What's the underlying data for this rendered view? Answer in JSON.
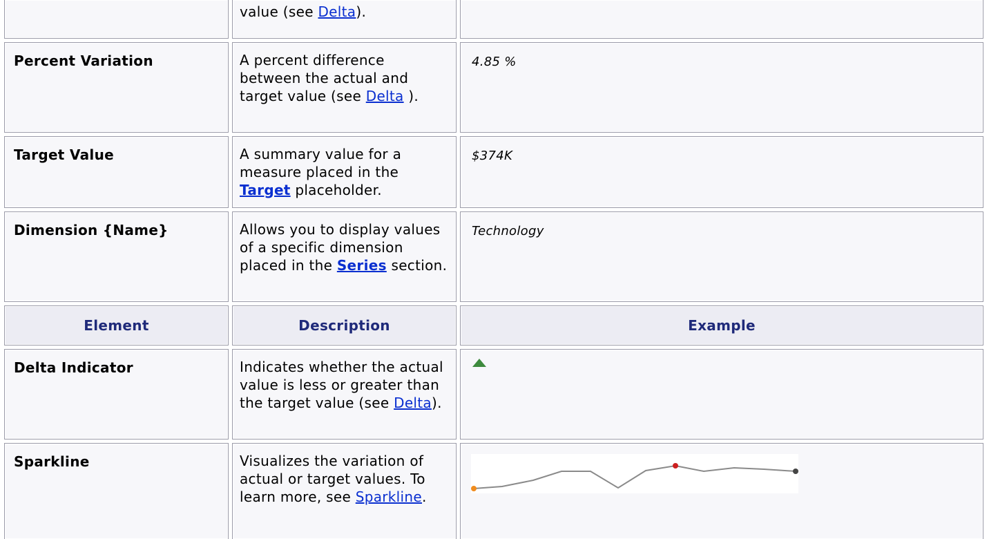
{
  "rows": [
    {
      "element": "",
      "description": [
        "value (see ",
        {
          "link": "Delta"
        },
        ")."
      ],
      "example": ""
    },
    {
      "element": "Percent Variation",
      "description": [
        "A percent difference between the actual and target value (see ",
        {
          "link": "Delta"
        },
        " )."
      ],
      "example": "4.85 %"
    },
    {
      "element": "Target Value",
      "description": [
        "A summary value for a measure placed in the ",
        {
          "link": "Target",
          "bold": true
        },
        " placeholder."
      ],
      "example": "$374K"
    },
    {
      "element": "Dimension {Name}",
      "description": [
        "Allows you to display values of a specific dimension placed in the ",
        {
          "link": "Series",
          "bold": true
        },
        " section."
      ],
      "example": "Technology"
    }
  ],
  "header": {
    "element": "Element",
    "description": "Description",
    "example": "Example"
  },
  "rows2": [
    {
      "element": "Delta Indicator",
      "description": [
        "Indicates whether the actual value is less or greater than the target value (see ",
        {
          "link": "Delta"
        },
        ")."
      ],
      "example_icon": "delta-up-triangle-icon"
    },
    {
      "element": "Sparkline",
      "description": [
        "Visualizes the variation of actual or target values. To learn more, see ",
        {
          "link": "Sparkline"
        },
        "."
      ],
      "example_icon": "sparkline-chart"
    }
  ],
  "colors": {
    "header_text": "#1f2a7a",
    "link": "#0a2fd0",
    "indicator_up": "#3d8a3d",
    "sparkline_line": "#8a8a8a",
    "sparkline_start": "#f08c1e",
    "sparkline_max": "#cc1f1f",
    "sparkline_end": "#444444"
  }
}
